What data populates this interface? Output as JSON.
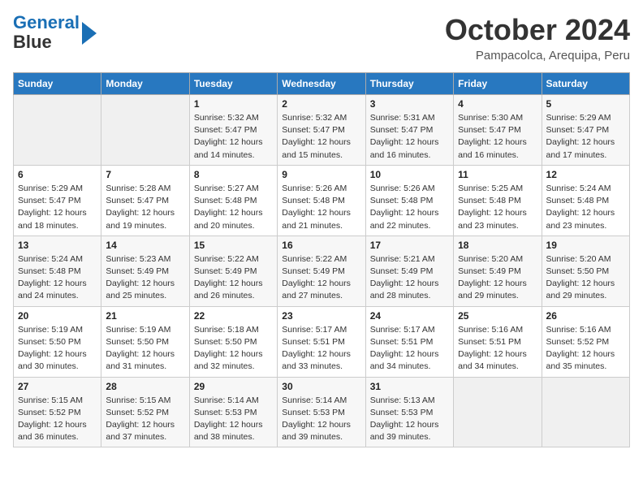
{
  "logo": {
    "line1": "General",
    "line2": "Blue"
  },
  "title": "October 2024",
  "location": "Pampacolca, Arequipa, Peru",
  "days_of_week": [
    "Sunday",
    "Monday",
    "Tuesday",
    "Wednesday",
    "Thursday",
    "Friday",
    "Saturday"
  ],
  "weeks": [
    [
      {
        "day": "",
        "info": ""
      },
      {
        "day": "",
        "info": ""
      },
      {
        "day": "1",
        "sunrise": "5:32 AM",
        "sunset": "5:47 PM",
        "daylight": "12 hours and 14 minutes."
      },
      {
        "day": "2",
        "sunrise": "5:32 AM",
        "sunset": "5:47 PM",
        "daylight": "12 hours and 15 minutes."
      },
      {
        "day": "3",
        "sunrise": "5:31 AM",
        "sunset": "5:47 PM",
        "daylight": "12 hours and 16 minutes."
      },
      {
        "day": "4",
        "sunrise": "5:30 AM",
        "sunset": "5:47 PM",
        "daylight": "12 hours and 16 minutes."
      },
      {
        "day": "5",
        "sunrise": "5:29 AM",
        "sunset": "5:47 PM",
        "daylight": "12 hours and 17 minutes."
      }
    ],
    [
      {
        "day": "6",
        "sunrise": "5:29 AM",
        "sunset": "5:47 PM",
        "daylight": "12 hours and 18 minutes."
      },
      {
        "day": "7",
        "sunrise": "5:28 AM",
        "sunset": "5:47 PM",
        "daylight": "12 hours and 19 minutes."
      },
      {
        "day": "8",
        "sunrise": "5:27 AM",
        "sunset": "5:48 PM",
        "daylight": "12 hours and 20 minutes."
      },
      {
        "day": "9",
        "sunrise": "5:26 AM",
        "sunset": "5:48 PM",
        "daylight": "12 hours and 21 minutes."
      },
      {
        "day": "10",
        "sunrise": "5:26 AM",
        "sunset": "5:48 PM",
        "daylight": "12 hours and 22 minutes."
      },
      {
        "day": "11",
        "sunrise": "5:25 AM",
        "sunset": "5:48 PM",
        "daylight": "12 hours and 23 minutes."
      },
      {
        "day": "12",
        "sunrise": "5:24 AM",
        "sunset": "5:48 PM",
        "daylight": "12 hours and 23 minutes."
      }
    ],
    [
      {
        "day": "13",
        "sunrise": "5:24 AM",
        "sunset": "5:48 PM",
        "daylight": "12 hours and 24 minutes."
      },
      {
        "day": "14",
        "sunrise": "5:23 AM",
        "sunset": "5:49 PM",
        "daylight": "12 hours and 25 minutes."
      },
      {
        "day": "15",
        "sunrise": "5:22 AM",
        "sunset": "5:49 PM",
        "daylight": "12 hours and 26 minutes."
      },
      {
        "day": "16",
        "sunrise": "5:22 AM",
        "sunset": "5:49 PM",
        "daylight": "12 hours and 27 minutes."
      },
      {
        "day": "17",
        "sunrise": "5:21 AM",
        "sunset": "5:49 PM",
        "daylight": "12 hours and 28 minutes."
      },
      {
        "day": "18",
        "sunrise": "5:20 AM",
        "sunset": "5:49 PM",
        "daylight": "12 hours and 29 minutes."
      },
      {
        "day": "19",
        "sunrise": "5:20 AM",
        "sunset": "5:50 PM",
        "daylight": "12 hours and 29 minutes."
      }
    ],
    [
      {
        "day": "20",
        "sunrise": "5:19 AM",
        "sunset": "5:50 PM",
        "daylight": "12 hours and 30 minutes."
      },
      {
        "day": "21",
        "sunrise": "5:19 AM",
        "sunset": "5:50 PM",
        "daylight": "12 hours and 31 minutes."
      },
      {
        "day": "22",
        "sunrise": "5:18 AM",
        "sunset": "5:50 PM",
        "daylight": "12 hours and 32 minutes."
      },
      {
        "day": "23",
        "sunrise": "5:17 AM",
        "sunset": "5:51 PM",
        "daylight": "12 hours and 33 minutes."
      },
      {
        "day": "24",
        "sunrise": "5:17 AM",
        "sunset": "5:51 PM",
        "daylight": "12 hours and 34 minutes."
      },
      {
        "day": "25",
        "sunrise": "5:16 AM",
        "sunset": "5:51 PM",
        "daylight": "12 hours and 34 minutes."
      },
      {
        "day": "26",
        "sunrise": "5:16 AM",
        "sunset": "5:52 PM",
        "daylight": "12 hours and 35 minutes."
      }
    ],
    [
      {
        "day": "27",
        "sunrise": "5:15 AM",
        "sunset": "5:52 PM",
        "daylight": "12 hours and 36 minutes."
      },
      {
        "day": "28",
        "sunrise": "5:15 AM",
        "sunset": "5:52 PM",
        "daylight": "12 hours and 37 minutes."
      },
      {
        "day": "29",
        "sunrise": "5:14 AM",
        "sunset": "5:53 PM",
        "daylight": "12 hours and 38 minutes."
      },
      {
        "day": "30",
        "sunrise": "5:14 AM",
        "sunset": "5:53 PM",
        "daylight": "12 hours and 39 minutes."
      },
      {
        "day": "31",
        "sunrise": "5:13 AM",
        "sunset": "5:53 PM",
        "daylight": "12 hours and 39 minutes."
      },
      {
        "day": "",
        "info": ""
      },
      {
        "day": "",
        "info": ""
      }
    ]
  ]
}
